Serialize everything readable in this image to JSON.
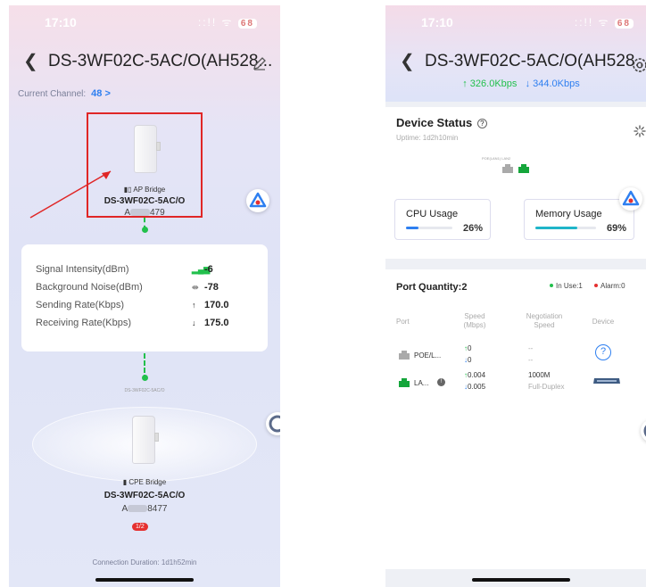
{
  "left": {
    "status": {
      "time": "17:10",
      "signal": "::!! ᯤ",
      "battery": "68"
    },
    "title": "DS-3WF02C-5AC/O(AH528...",
    "channel_label": "Current Channel:",
    "channel_value": "48 >",
    "ap": {
      "role": "AP Bridge",
      "model": "DS-3WF02C-5AC/O",
      "serial_prefix": "A",
      "serial_suffix": "479"
    },
    "stats": [
      {
        "label": "Signal Intensity(dBm)",
        "icon": "signal-bars-icon",
        "value": "-6"
      },
      {
        "label": "Background Noise(dBm)",
        "icon": "noise-icon",
        "value": "-78"
      },
      {
        "label": "Sending Rate(Kbps)",
        "icon": "arrow-up-icon",
        "value": "170.0"
      },
      {
        "label": "Receiving Rate(Kbps)",
        "icon": "arrow-down-icon",
        "value": "175.0"
      }
    ],
    "mid_small_label_1": "DS-3WF02C-5AC/O",
    "cpe": {
      "role": "CPE Bridge",
      "model": "DS-3WF02C-5AC/O",
      "serial_prefix": "A",
      "serial_suffix": "8477"
    },
    "badge": "1/2",
    "duration": "Connection Duration: 1d1h52min"
  },
  "right": {
    "status": {
      "time": "17:10",
      "signal": "::!! ᯤ",
      "battery": "68"
    },
    "title": "DS-3WF02C-5AC/O(AH528...",
    "rate_up": "↑ 326.0Kbps",
    "rate_down": "↓ 344.0Kbps",
    "device_status": {
      "title": "Device Status",
      "uptime": "Uptime: 1d2h10min",
      "port_labels": "POE(LAN1) LAN2",
      "cpu_label": "CPU Usage",
      "cpu_value": "26%",
      "cpu_fraction": 0.26,
      "mem_label": "Memory Usage",
      "mem_value": "69%",
      "mem_fraction": 0.69
    },
    "ports": {
      "title": "Port Quantity:2",
      "legend_inuse": "In Use:1",
      "legend_alarm": "Alarm:0",
      "headers": {
        "port": "Port",
        "speed": "Speed (Mbps)",
        "negotiation": "Negotiation Speed",
        "device": "Device"
      },
      "rows": [
        {
          "name": "POE/L...",
          "up": "0",
          "down": "0",
          "neg1": "--",
          "neg2": "--"
        },
        {
          "name": "LA...",
          "up": "0.004",
          "down": "0.005",
          "neg1": "1000M",
          "neg2": "Full-Duplex"
        }
      ]
    }
  },
  "colors": {
    "accent": "#2e7ff0",
    "green": "#22c04c",
    "alarm": "#e53030"
  }
}
